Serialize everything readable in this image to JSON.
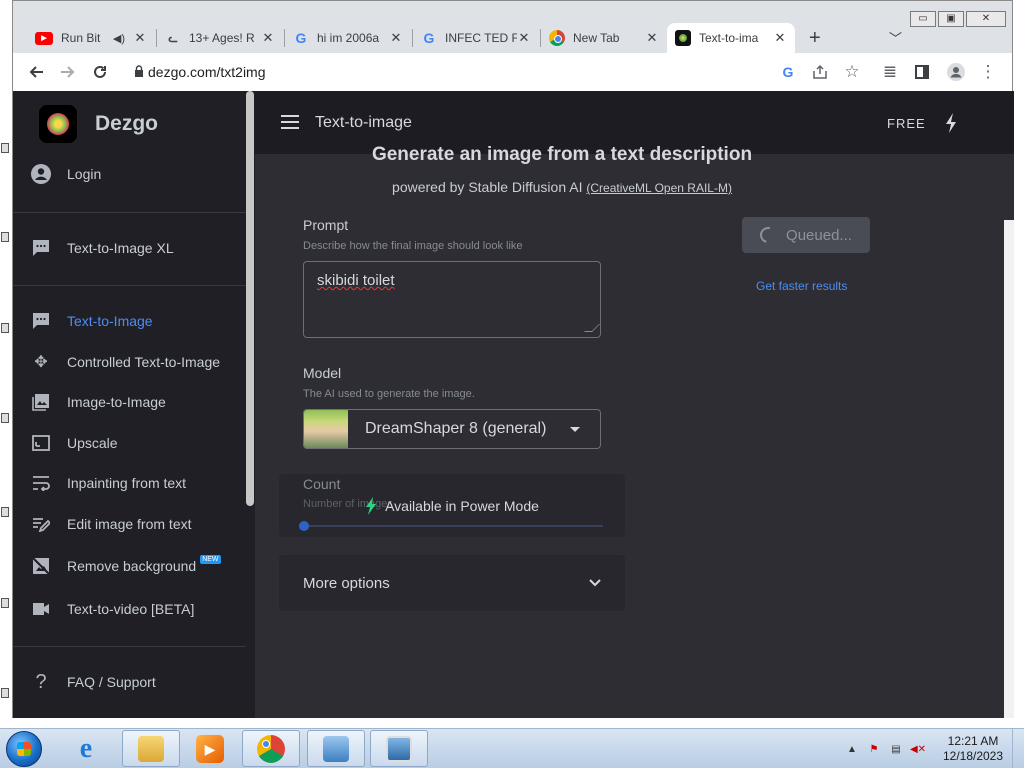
{
  "browser": {
    "tabs": [
      {
        "title": "Run Bit",
        "favicon": "youtube-icon",
        "audio": true,
        "active": false
      },
      {
        "title": "13+ Ages! R",
        "favicon": "cat-icon",
        "active": false
      },
      {
        "title": "hi im 2006a",
        "favicon": "google-icon",
        "active": false
      },
      {
        "title": "INFEC TED F",
        "favicon": "google-icon",
        "active": false
      },
      {
        "title": "New Tab",
        "favicon": "chrome-icon",
        "active": false
      },
      {
        "title": "Text-to-ima",
        "favicon": "dezgo-icon",
        "active": true
      }
    ],
    "new_tab_symbol": "+",
    "url": "dezgo.com/txt2img"
  },
  "sidebar": {
    "brand": "Dezgo",
    "login": "Login",
    "items": [
      {
        "label": "Text-to-Image XL",
        "icon": "chat-icon"
      },
      {
        "label": "Text-to-Image",
        "icon": "chat-icon",
        "active": true
      },
      {
        "label": "Controlled Text-to-Image",
        "icon": "move-icon"
      },
      {
        "label": "Image-to-Image",
        "icon": "image-icon"
      },
      {
        "label": "Upscale",
        "icon": "upscale-icon"
      },
      {
        "label": "Inpainting from text",
        "icon": "wrap-icon"
      },
      {
        "label": "Edit image from text",
        "icon": "edit-icon"
      },
      {
        "label": "Remove background",
        "icon": "hide-image-icon",
        "badge": "NEW"
      },
      {
        "label": "Text-to-video [BETA]",
        "icon": "video-icon"
      },
      {
        "label": "FAQ / Support",
        "icon": "question-icon"
      }
    ]
  },
  "header": {
    "title": "Text-to-image",
    "plan": "FREE"
  },
  "main": {
    "heading": "Generate an image from a text description",
    "subtitle": "powered by Stable Diffusion AI",
    "license": "(CreativeML Open RAIL-M)",
    "prompt": {
      "label": "Prompt",
      "help": "Describe how the final image should look like",
      "value": "skibidi toilet"
    },
    "model": {
      "label": "Model",
      "help": "The AI used to generate the image.",
      "value": "DreamShaper 8 (general)"
    },
    "count": {
      "label": "Count",
      "help": "Number of images",
      "overlay": "Available in Power Mode",
      "value_fraction": 0
    },
    "more_options": "More options",
    "queued": "Queued...",
    "faster_link": "Get faster results"
  },
  "taskbar": {
    "time": "12:21 AM",
    "date": "12/18/2023"
  },
  "colors": {
    "accent": "#4c8df6",
    "power_bolt": "#2bd47d",
    "sidebar_bg": "#1f1f25",
    "main_bg": "#2d2d33"
  }
}
